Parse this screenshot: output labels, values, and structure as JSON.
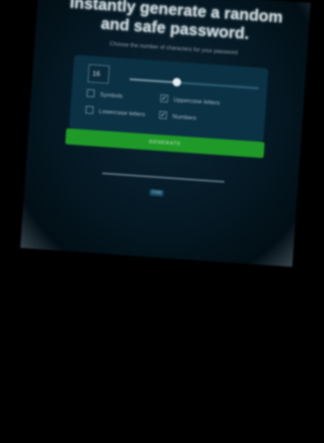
{
  "headline": {
    "line1": "Instantly generate a random",
    "line2": "and safe password."
  },
  "subtitle": "Choose the number of characters for your password",
  "length": {
    "value": "16",
    "slider_fraction": 0.5
  },
  "options": {
    "symbols": {
      "label": "Symbols",
      "checked": false
    },
    "uppercase": {
      "label": "Uppercase letters",
      "checked": true
    },
    "lowercase": {
      "label": "Lowercase letters",
      "checked": false
    },
    "numbers": {
      "label": "Numbers",
      "checked": true
    }
  },
  "generate_label": "GENERATE",
  "copy_label": "Copy",
  "colors": {
    "background": "#041823",
    "panel": "#0b3144",
    "button": "#1f9a28",
    "text": "#c9d4d9"
  }
}
